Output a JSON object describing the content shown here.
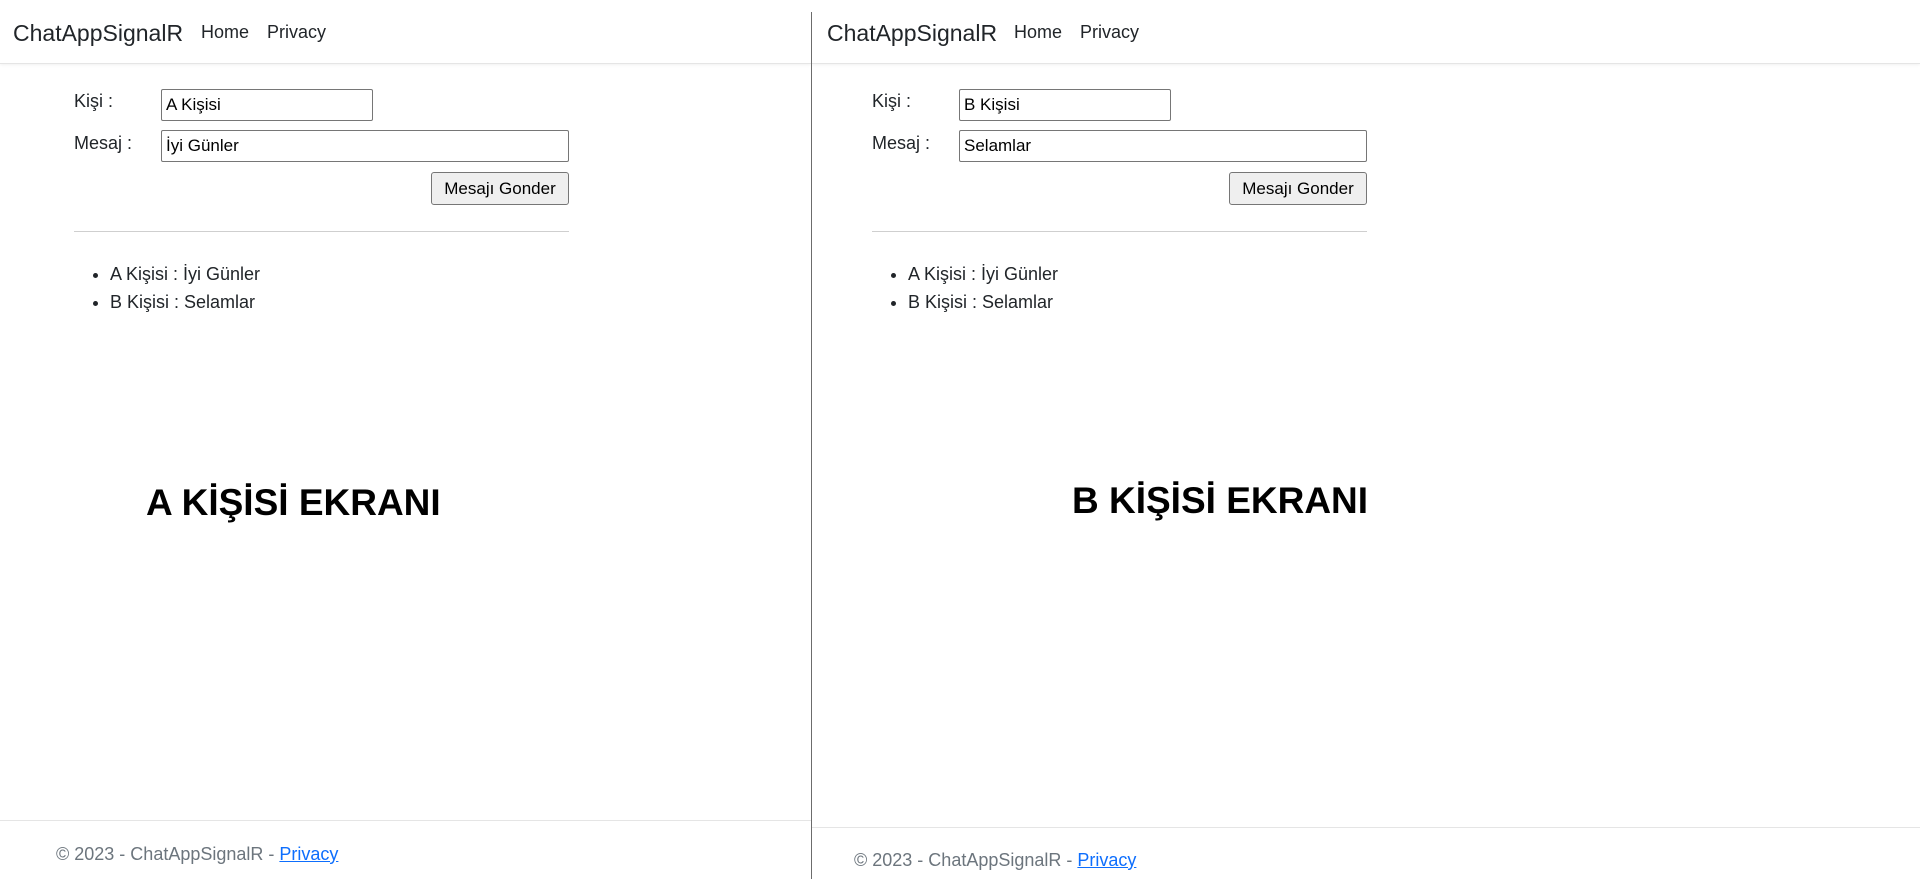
{
  "panes": {
    "a": {
      "brand": "ChatAppSignalR",
      "nav": [
        "Home",
        "Privacy"
      ],
      "form": {
        "person_label": "Kişi :",
        "person_value": "A Kişisi",
        "message_label": "Mesaj :",
        "message_value": "İyi Günler",
        "send_label": "Mesajı Gonder"
      },
      "messages": [
        "A Kişisi : İyi Günler",
        "B Kişisi : Selamlar"
      ],
      "screen_title": "A KİŞİSİ EKRANI",
      "footer": {
        "text": "© 2023 - ChatAppSignalR - ",
        "link": "Privacy"
      }
    },
    "b": {
      "brand": "ChatAppSignalR",
      "nav": [
        "Home",
        "Privacy"
      ],
      "form": {
        "person_label": "Kişi :",
        "person_value": "B Kişisi",
        "message_label": "Mesaj :",
        "message_value": "Selamlar",
        "send_label": "Mesajı Gonder"
      },
      "messages": [
        "A Kişisi : İyi Günler",
        "B Kişisi : Selamlar"
      ],
      "screen_title": "B KİŞİSİ EKRANI",
      "footer": {
        "text": "© 2023 - ChatAppSignalR - ",
        "link": "Privacy"
      }
    }
  },
  "colors": {
    "link": "#0d6efd",
    "muted": "#6c757d",
    "text": "#212529"
  }
}
